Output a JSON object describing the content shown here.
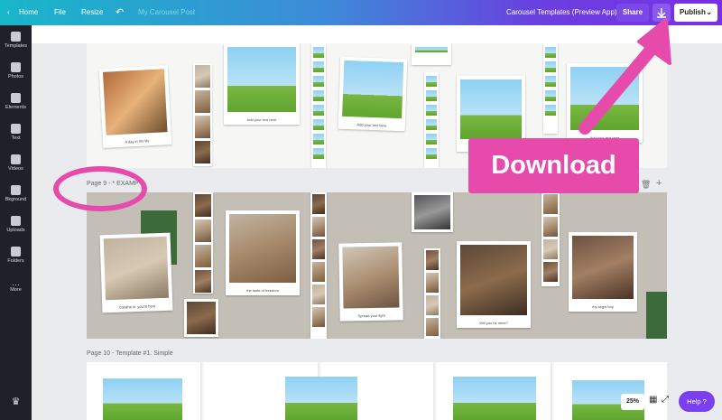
{
  "topbar": {
    "home": "Home",
    "file": "File",
    "resize": "Resize",
    "design_name": "My Carousel Post",
    "app_title": "Carousel Templates (Preview App)",
    "share": "Share",
    "publish": "Publish"
  },
  "sidebar": {
    "items": [
      {
        "label": "Templates",
        "icon": "templates-icon"
      },
      {
        "label": "Photos",
        "icon": "photos-icon"
      },
      {
        "label": "Elements",
        "icon": "elements-icon"
      },
      {
        "label": "Text",
        "icon": "text-icon"
      },
      {
        "label": "Videos",
        "icon": "videos-icon"
      },
      {
        "label": "Bkground",
        "icon": "background-icon"
      },
      {
        "label": "Uploads",
        "icon": "uploads-icon"
      },
      {
        "label": "Folders",
        "icon": "folders-icon"
      },
      {
        "label": "More",
        "icon": "more-icon"
      }
    ]
  },
  "pages": {
    "page8_captions": [
      "A day in the life",
      "Add your text here",
      "Add your text here",
      "Add your text here"
    ],
    "page9_label": "Page 9 - * EXAMP",
    "page9_captions": [
      "breathe in. you're here",
      "the taste of freedom",
      "Spread your light",
      "Will you be mine?",
      "my angel boy"
    ],
    "page10_label": "Page 10 - Template #1. Simple"
  },
  "overlay": {
    "download_text": "Download"
  },
  "footer": {
    "zoom": "25%",
    "help": "Help ?"
  },
  "colors": {
    "accent_pink": "#e64bac",
    "purple": "#7a3ff0"
  }
}
